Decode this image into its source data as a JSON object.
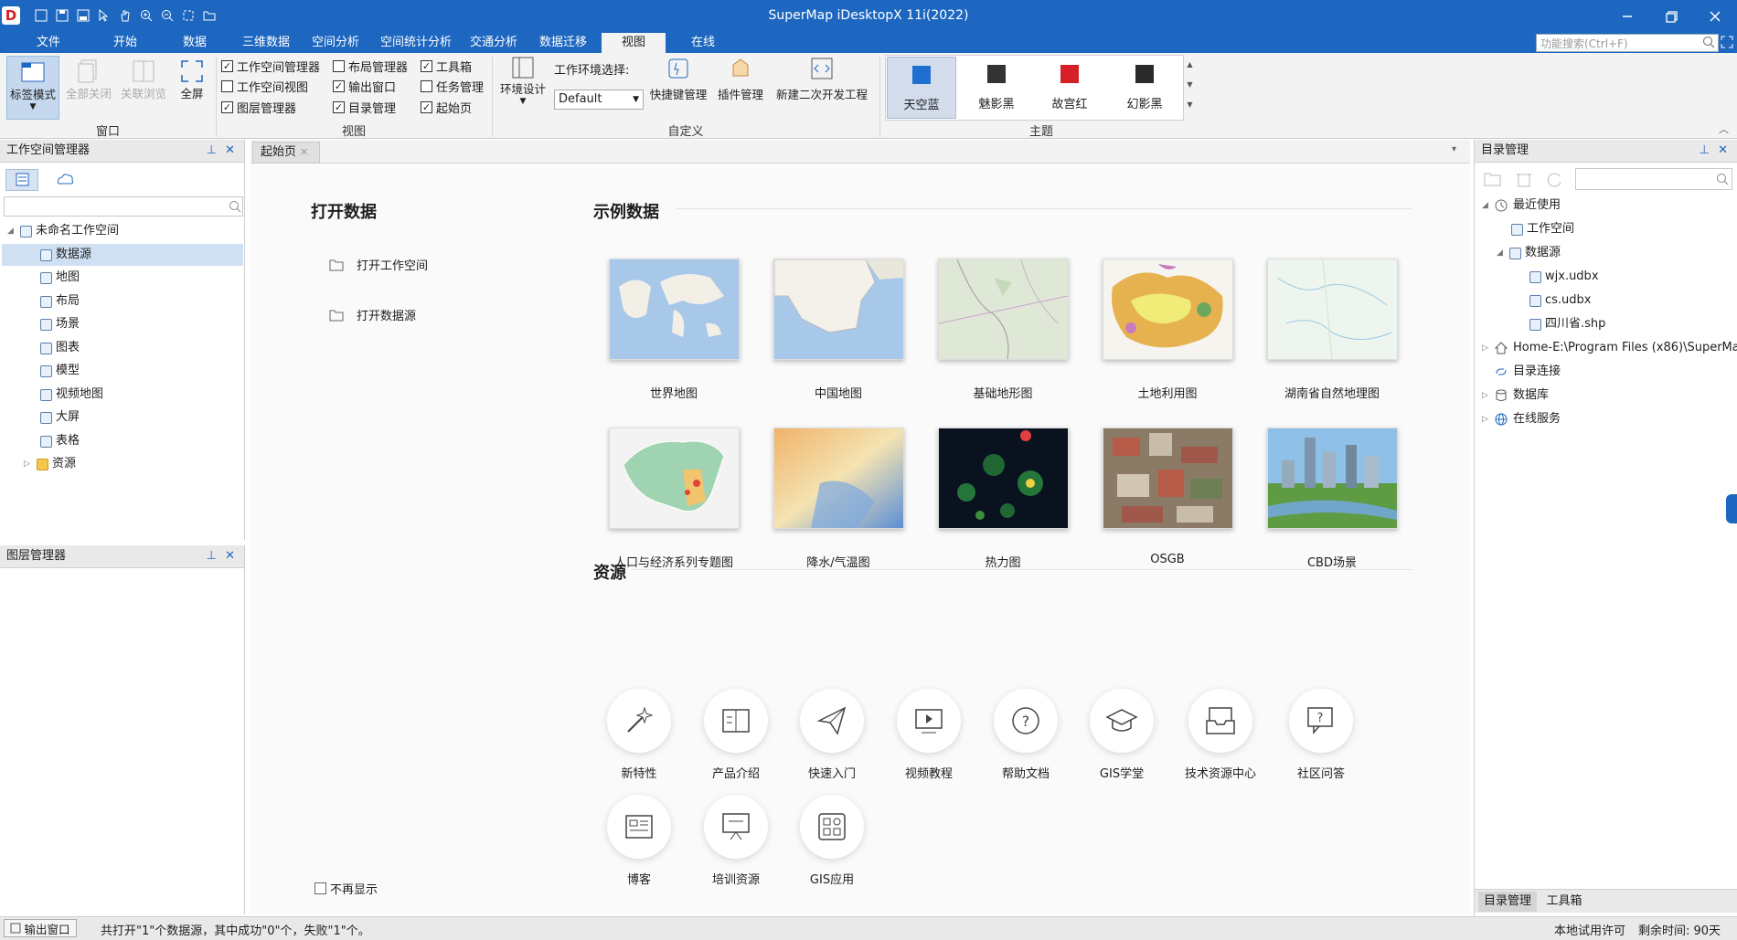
{
  "app": {
    "title": "SuperMap iDesktopX 11i(2022)"
  },
  "menu": {
    "items": [
      "文件",
      "开始",
      "数据",
      "三维数据",
      "空间分析",
      "空间统计分析",
      "交通分析",
      "数据迁移",
      "视图",
      "在线"
    ],
    "active": "视图",
    "search_placeholder": "功能搜索(Ctrl+F)"
  },
  "ribbon": {
    "window": {
      "label": "窗口",
      "buttons": [
        "标签模式",
        "全部关闭",
        "关联浏览",
        "全屏"
      ]
    },
    "view": {
      "label": "视图",
      "checks": [
        {
          "label": "工作空间管理器",
          "checked": true
        },
        {
          "label": "工作空间视图",
          "checked": false
        },
        {
          "label": "图层管理器",
          "checked": true
        },
        {
          "label": "布局管理器",
          "checked": false
        },
        {
          "label": "输出窗口",
          "checked": true
        },
        {
          "label": "目录管理",
          "checked": true
        },
        {
          "label": "工具箱",
          "checked": true
        },
        {
          "label": "任务管理",
          "checked": false
        },
        {
          "label": "起始页",
          "checked": true
        }
      ]
    },
    "custom": {
      "label": "自定义",
      "env_design": "环境设计",
      "env_select": "工作环境选择:",
      "env_value": "Default",
      "shortcut": "快捷键管理",
      "plugin": "插件管理",
      "new_project": "新建二次开发工程"
    },
    "theme": {
      "label": "主题",
      "items": [
        {
          "name": "天空蓝",
          "color": "#1f6fd0",
          "active": true
        },
        {
          "name": "魅影黑",
          "color": "#333333",
          "active": false
        },
        {
          "name": "故宫红",
          "color": "#d42026",
          "active": false
        },
        {
          "name": "幻影黑",
          "color": "#2a2a2a",
          "active": false
        }
      ]
    }
  },
  "workspace": {
    "title": "工作空间管理器",
    "root": "未命名工作空间",
    "items": [
      "数据源",
      "地图",
      "布局",
      "场景",
      "图表",
      "模型",
      "视频地图",
      "大屏",
      "表格",
      "资源"
    ],
    "selected": "数据源"
  },
  "layers": {
    "title": "图层管理器"
  },
  "tab": {
    "label": "起始页"
  },
  "start": {
    "open_title": "打开数据",
    "open_items": [
      "打开工作空间",
      "打开数据源"
    ],
    "sample_title": "示例数据",
    "samples": [
      "世界地图",
      "中国地图",
      "基础地形图",
      "土地利用图",
      "湖南省自然地理图",
      "人口与经济系列专题图",
      "降水/气温图",
      "热力图",
      "OSGB",
      "CBD场景"
    ],
    "res_title": "资源",
    "resources": [
      "新特性",
      "产品介绍",
      "快速入门",
      "视频教程",
      "帮助文档",
      "GIS学堂",
      "技术资源中心",
      "社区问答",
      "博客",
      "培训资源",
      "GIS应用"
    ],
    "dont_show": "不再显示"
  },
  "catalog": {
    "title": "目录管理",
    "recent": "最近使用",
    "workspace": "工作空间",
    "datasource": "数据源",
    "files": [
      "wjx.udbx",
      "cs.udbx",
      "四川省.shp"
    ],
    "home": "Home-E:\\Program Files (x86)\\SuperMa...",
    "dir_conn": "目录连接",
    "database": "数据库",
    "online": "在线服务",
    "bottom_tabs": [
      "目录管理",
      "工具箱"
    ]
  },
  "status": {
    "output": "输出窗口",
    "message": "共打开\"1\"个数据源，其中成功\"0\"个，失败\"1\"个。",
    "license": "本地试用许可",
    "remaining": "剩余时间: 90天"
  }
}
